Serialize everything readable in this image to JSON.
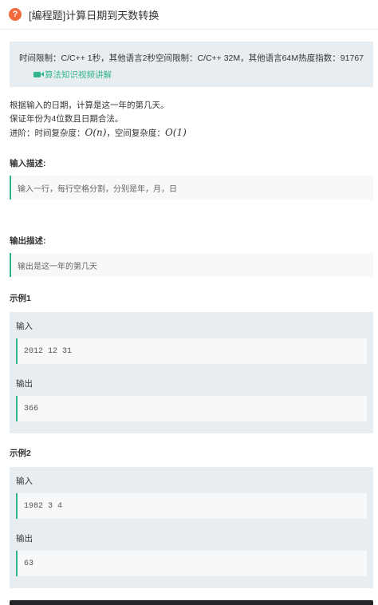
{
  "header": {
    "icon": "question-icon",
    "icon_glyph": "?",
    "title": "[编程题]计算日期到天数转换"
  },
  "info": {
    "time_limit": "时间限制：C/C++ 1秒，其他语言2秒",
    "space_limit": "空间限制：C/C++ 32M，其他语言64M",
    "heat": "热度指数：91767",
    "video_link": "算法知识视频讲解"
  },
  "description": {
    "line1": "根据输入的日期，计算是这一年的第几天。",
    "line2": "保证年份为4位数且日期合法。",
    "line3_prefix": "进阶：时间复杂度：",
    "line3_math1": "O(n)",
    "line3_middle": "，空间复杂度：",
    "line3_math2": "O(1)"
  },
  "input_section": {
    "label": "输入描述:",
    "text": "输入一行，每行空格分割，分别是年，月，日"
  },
  "output_section": {
    "label": "输出描述:",
    "text": "输出是这一年的第几天"
  },
  "examples": [
    {
      "label": "示例1",
      "input_label": "输入",
      "input": "2012 12 31",
      "output_label": "输出",
      "output": "366"
    },
    {
      "label": "示例2",
      "input_label": "输入",
      "input": "1982 3 4",
      "output_label": "输出",
      "output": "63"
    }
  ],
  "colors": {
    "accent": "#32b58c",
    "panel": "#e8edf1",
    "icon": "#f26a3d"
  }
}
